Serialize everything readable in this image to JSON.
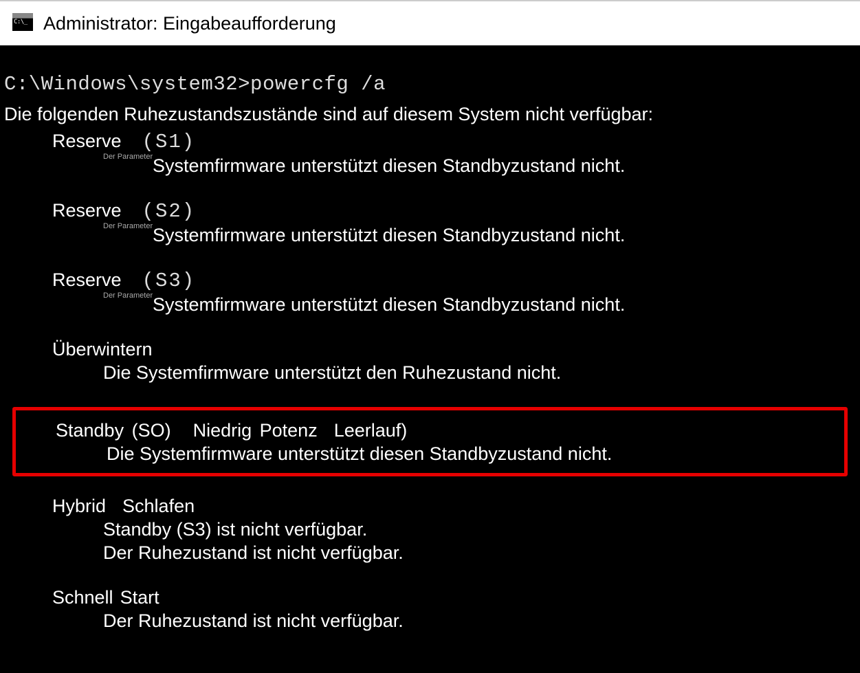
{
  "titlebar": {
    "text": "Administrator: Eingabeaufforderung"
  },
  "prompt": "C:\\Windows\\system32>powercfg /a",
  "output": {
    "header": "Die folgenden Ruhezustandszustände sind auf diesem System nicht verfügbar:",
    "param_note": "Der Parameter",
    "states": [
      {
        "label": "Reserve",
        "code": "(S1)",
        "param_note": true,
        "reason": "Systemfirmware unterstützt diesen Standbyzustand nicht."
      },
      {
        "label": "Reserve",
        "code": "(S2)",
        "param_note": true,
        "reason": "Systemfirmware unterstützt diesen Standbyzustand nicht."
      },
      {
        "label": "Reserve",
        "code": "(S3)",
        "param_note": true,
        "reason": "Systemfirmware unterstützt diesen Standbyzustand nicht."
      }
    ],
    "hibernate": {
      "label": "Überwintern",
      "reason": "Die Systemfirmware unterstützt den Ruhezustand nicht."
    },
    "s0": {
      "label_part1": "Standby (SO)",
      "label_part2": "Niedrig",
      "label_part3": "Potenz",
      "label_part4": "Leerlauf)",
      "reason": "Die Systemfirmware unterstützt diesen Standbyzustand nicht."
    },
    "hybrid": {
      "w1": "Hybrid",
      "w2": "Schlafen",
      "reason1": "Standby (S3) ist nicht verfügbar.",
      "reason2": "Der Ruhezustand ist nicht verfügbar."
    },
    "fast": {
      "w1": "Schnell",
      "w2": "Start",
      "reason": "Der Ruhezustand ist nicht verfügbar."
    }
  }
}
